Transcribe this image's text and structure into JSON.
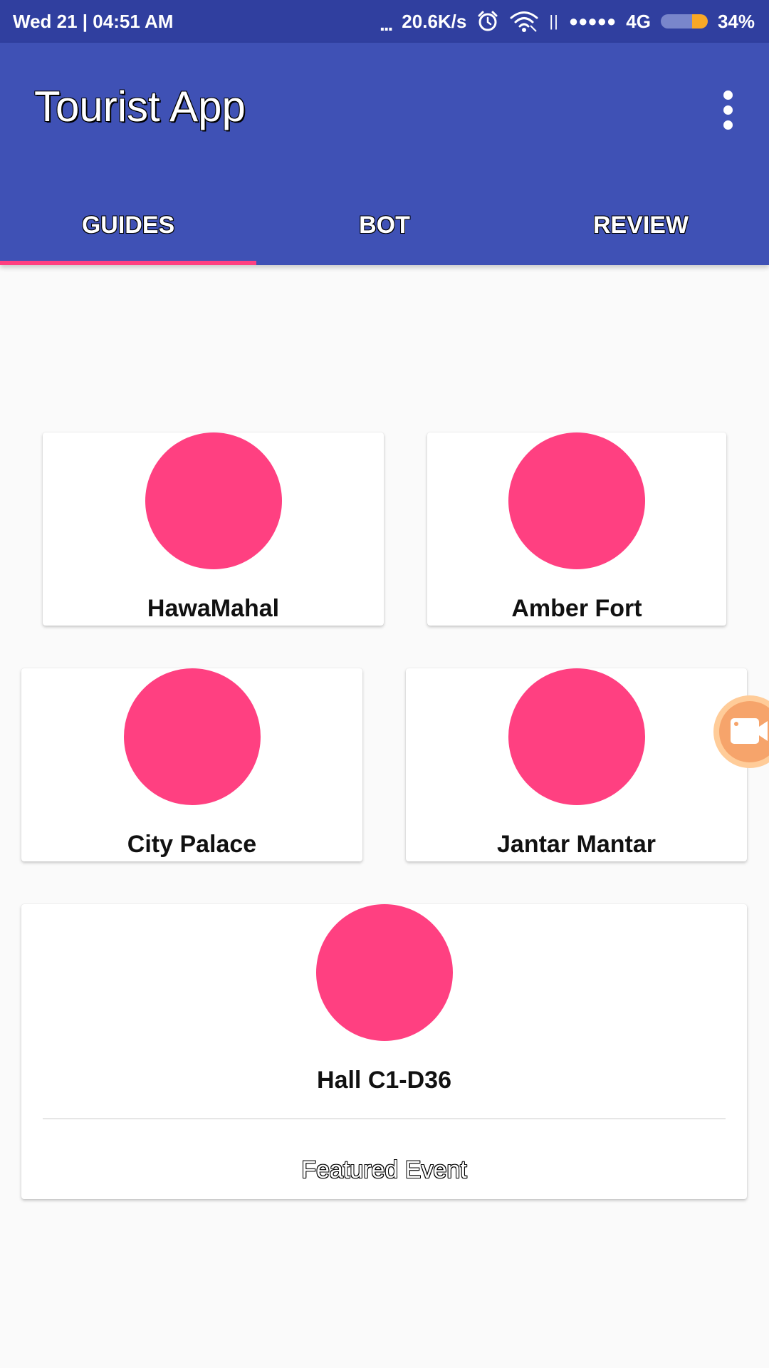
{
  "status_bar": {
    "datetime": "Wed 21 | 04:51 AM",
    "more_indicator": "...",
    "network_speed": "20.6K/s",
    "sim_bars": "||",
    "signal_dots": "●●●●●",
    "network_type": "4G",
    "battery_percent": "34%",
    "battery_level": 0.34,
    "icons": [
      "alarm-icon",
      "wifi-icon",
      "battery-icon"
    ]
  },
  "app_bar": {
    "title": "Tourist App",
    "menu_icon": "overflow-menu-icon",
    "color": "#3f51b5"
  },
  "tabs": [
    {
      "label": "GUIDES",
      "selected": true
    },
    {
      "label": "BOT",
      "selected": false
    },
    {
      "label": "REVIEW",
      "selected": false
    }
  ],
  "accent_color": "#ff4081",
  "guides": [
    {
      "label": "HawaMahal"
    },
    {
      "label": "Amber Fort"
    },
    {
      "label": "City Palace"
    },
    {
      "label": "Jantar Mantar"
    },
    {
      "label": "Hall C1-D36",
      "footer": "Featured Event"
    }
  ],
  "floating_bubble": {
    "icon": "video-camera-icon",
    "color": "#f6a46b"
  }
}
